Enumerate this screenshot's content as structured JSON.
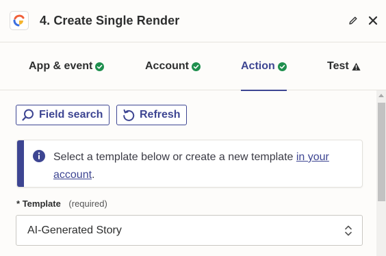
{
  "header": {
    "title": "4. Create Single Render",
    "app_icon": "creatomate-logo",
    "edit_icon": "pencil-icon",
    "close_icon": "close-icon"
  },
  "tabs": [
    {
      "label": "App & event",
      "status": "complete",
      "icon": "check-circle-icon"
    },
    {
      "label": "Account",
      "status": "complete",
      "icon": "check-circle-icon"
    },
    {
      "label": "Action",
      "status": "complete",
      "icon": "check-circle-icon",
      "active": true
    },
    {
      "label": "Test",
      "status": "warning",
      "icon": "warning-triangle-icon"
    }
  ],
  "toolbar": {
    "field_search_label": "Field search",
    "refresh_label": "Refresh"
  },
  "info": {
    "text_before": "Select a template below or create a new template ",
    "link_text": "in your account",
    "text_after": "."
  },
  "template_field": {
    "required_marker": "*",
    "label": "Template",
    "required_text": "(required)",
    "value": "AI-Generated Story"
  },
  "colors": {
    "accent": "#3d4592",
    "success": "#1f8f4e",
    "warning": "#2d2e2e"
  }
}
